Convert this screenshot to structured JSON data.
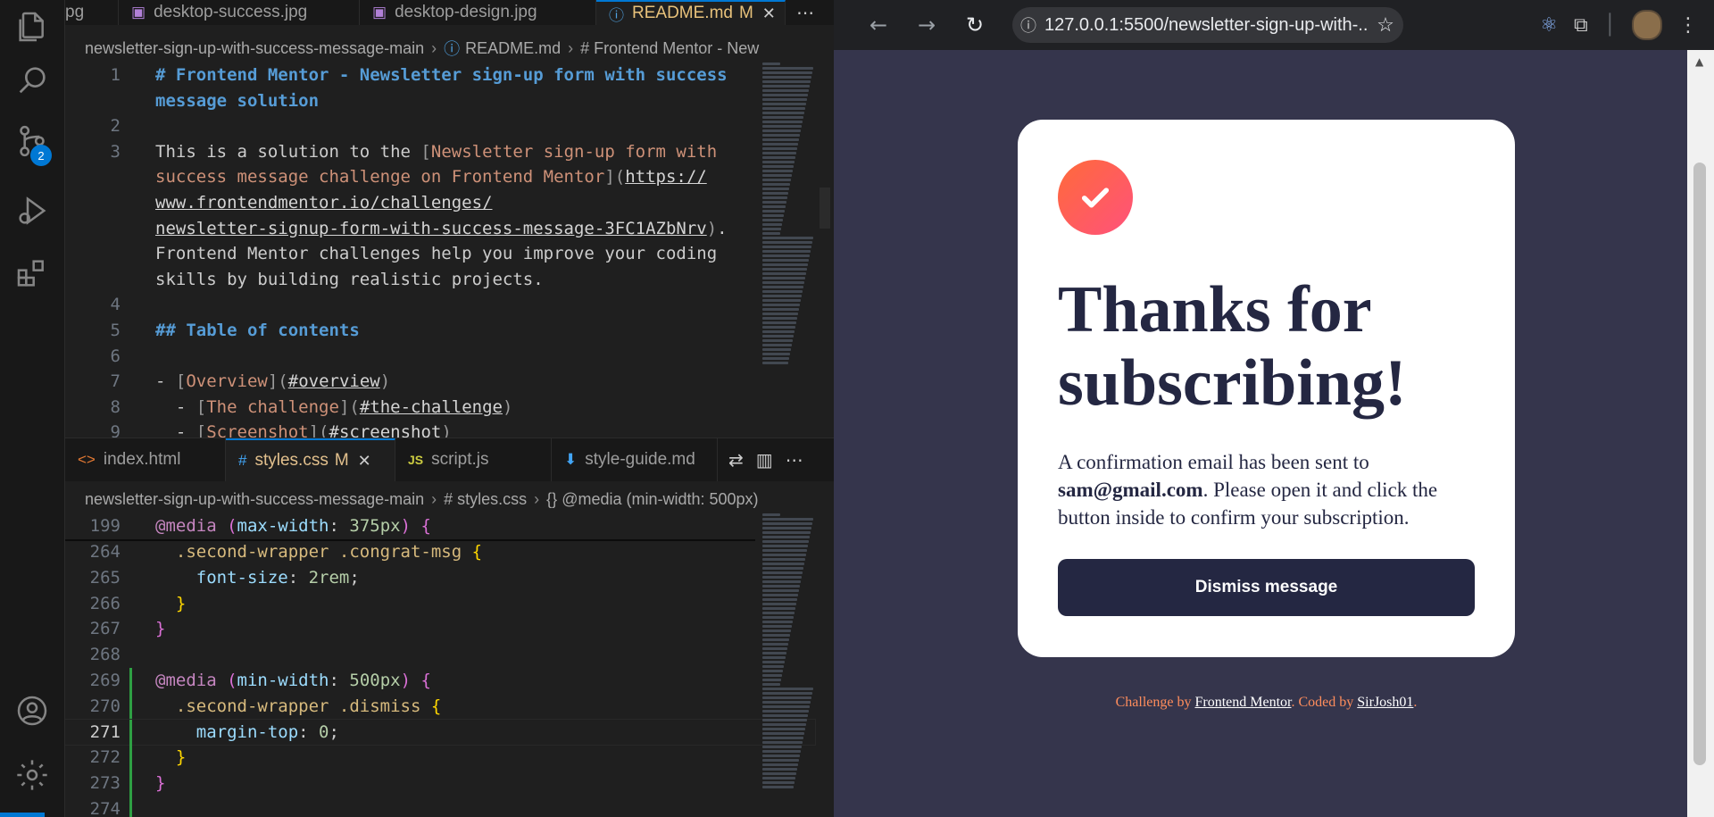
{
  "vscode": {
    "scm_badge": "2",
    "top_tabs": [
      {
        "label": "pg",
        "icon": "image-icon"
      },
      {
        "label": "desktop-success.jpg",
        "icon": "image-icon"
      },
      {
        "label": "desktop-design.jpg",
        "icon": "image-icon"
      },
      {
        "label": "README.md",
        "modified": "M",
        "icon": "info-icon"
      }
    ],
    "top_breadcrumb": [
      "newsletter-sign-up-with-success-message-main",
      "README.md",
      "# Frontend Mentor - New"
    ],
    "readme": {
      "line_numbers": [
        "1",
        "",
        "2",
        "3",
        "",
        "",
        "",
        "",
        "",
        "4",
        "5",
        "6",
        "7",
        "8",
        "9"
      ],
      "rows": [
        {
          "ln": "1",
          "parts": [
            {
              "c": "k-h",
              "t": "# Frontend Mentor - Newsletter sign-up form with success"
            }
          ]
        },
        {
          "ln": "",
          "parts": [
            {
              "c": "k-h",
              "t": "message solution"
            }
          ]
        },
        {
          "ln": "2",
          "parts": []
        },
        {
          "ln": "3",
          "parts": [
            {
              "c": "",
              "t": "This is a solution to the "
            },
            {
              "c": "k-br",
              "t": "["
            },
            {
              "c": "k-link",
              "t": "Newsletter sign-up form with"
            }
          ]
        },
        {
          "ln": "",
          "parts": [
            {
              "c": "k-link",
              "t": "success message challenge on Frontend Mentor"
            },
            {
              "c": "k-br",
              "t": "]("
            },
            {
              "c": "k-url",
              "t": "https://"
            }
          ]
        },
        {
          "ln": "",
          "parts": [
            {
              "c": "k-url",
              "t": "www.frontendmentor.io/challenges/"
            }
          ]
        },
        {
          "ln": "",
          "parts": [
            {
              "c": "k-url",
              "t": "newsletter-signup-form-with-success-message-3FC1AZbNrv"
            },
            {
              "c": "k-br",
              "t": ")"
            },
            {
              "c": "",
              "t": "."
            }
          ]
        },
        {
          "ln": "",
          "parts": [
            {
              "c": "",
              "t": "Frontend Mentor challenges help you improve your coding"
            }
          ]
        },
        {
          "ln": "",
          "parts": [
            {
              "c": "",
              "t": "skills by building realistic projects."
            }
          ]
        },
        {
          "ln": "4",
          "parts": []
        },
        {
          "ln": "5",
          "parts": [
            {
              "c": "k-h",
              "t": "## Table of contents"
            }
          ]
        },
        {
          "ln": "6",
          "parts": []
        },
        {
          "ln": "7",
          "parts": [
            {
              "c": "",
              "t": "- "
            },
            {
              "c": "k-br",
              "t": "["
            },
            {
              "c": "k-link",
              "t": "Overview"
            },
            {
              "c": "k-br",
              "t": "]("
            },
            {
              "c": "k-url",
              "t": "#overview"
            },
            {
              "c": "k-br",
              "t": ")"
            }
          ]
        },
        {
          "ln": "8",
          "parts": [
            {
              "c": "",
              "t": "  - "
            },
            {
              "c": "k-br",
              "t": "["
            },
            {
              "c": "k-link",
              "t": "The challenge"
            },
            {
              "c": "k-br",
              "t": "]("
            },
            {
              "c": "k-url",
              "t": "#the-challenge"
            },
            {
              "c": "k-br",
              "t": ")"
            }
          ]
        },
        {
          "ln": "9",
          "parts": [
            {
              "c": "",
              "t": "  - "
            },
            {
              "c": "k-br",
              "t": "["
            },
            {
              "c": "k-link",
              "t": "Screenshot"
            },
            {
              "c": "k-br",
              "t": "]("
            },
            {
              "c": "k-url",
              "t": "#screenshot"
            },
            {
              "c": "k-br",
              "t": ")"
            }
          ]
        }
      ]
    },
    "bottom_tabs": [
      {
        "label": "index.html",
        "icon": "html-icon",
        "ic": "<>"
      },
      {
        "label": "styles.css",
        "modified": "M",
        "icon": "css-icon",
        "ic": "#"
      },
      {
        "label": "script.js",
        "icon": "js-icon",
        "ic": "JS"
      },
      {
        "label": "style-guide.md",
        "icon": "markdown-icon",
        "ic": "⬇"
      }
    ],
    "bottom_breadcrumb": [
      "newsletter-sign-up-with-success-message-main",
      "# styles.css",
      "{} @media (min-width: 500px)"
    ],
    "css": {
      "sticky": {
        "ln": "199",
        "parts": [
          {
            "c": "k-at",
            "t": "@media"
          },
          {
            "c": "",
            "t": " "
          },
          {
            "c": "k-paren",
            "t": "("
          },
          {
            "c": "k-prop",
            "t": "max-width"
          },
          {
            "c": "",
            "t": ": "
          },
          {
            "c": "k-num",
            "t": "375px"
          },
          {
            "c": "k-paren",
            "t": ")"
          },
          {
            "c": "",
            "t": " "
          },
          {
            "c": "k-paren",
            "t": "{"
          }
        ]
      },
      "rows": [
        {
          "ln": "264",
          "parts": [
            {
              "c": "",
              "t": "  "
            },
            {
              "c": "k-sel",
              "t": ".second-wrapper .congrat-msg"
            },
            {
              "c": "",
              "t": " "
            },
            {
              "c": "k-brace",
              "t": "{"
            }
          ]
        },
        {
          "ln": "265",
          "parts": [
            {
              "c": "",
              "t": "    "
            },
            {
              "c": "k-prop",
              "t": "font-size"
            },
            {
              "c": "",
              "t": ": "
            },
            {
              "c": "k-num",
              "t": "2rem"
            },
            {
              "c": "",
              "t": ";"
            }
          ]
        },
        {
          "ln": "266",
          "parts": [
            {
              "c": "",
              "t": "  "
            },
            {
              "c": "k-brace",
              "t": "}"
            }
          ]
        },
        {
          "ln": "267",
          "parts": [
            {
              "c": "k-paren",
              "t": "}"
            }
          ]
        },
        {
          "ln": "268",
          "parts": []
        },
        {
          "ln": "269",
          "parts": [
            {
              "c": "k-at",
              "t": "@media"
            },
            {
              "c": "",
              "t": " "
            },
            {
              "c": "k-paren",
              "t": "("
            },
            {
              "c": "k-prop",
              "t": "min-width"
            },
            {
              "c": "",
              "t": ": "
            },
            {
              "c": "k-num",
              "t": "500px"
            },
            {
              "c": "k-paren",
              "t": ")"
            },
            {
              "c": "",
              "t": " "
            },
            {
              "c": "k-paren",
              "t": "{"
            }
          ]
        },
        {
          "ln": "270",
          "parts": [
            {
              "c": "",
              "t": "  "
            },
            {
              "c": "k-sel",
              "t": ".second-wrapper .dismiss"
            },
            {
              "c": "",
              "t": " "
            },
            {
              "c": "k-brace",
              "t": "{"
            }
          ]
        },
        {
          "ln": "271",
          "parts": [
            {
              "c": "",
              "t": "    "
            },
            {
              "c": "k-prop",
              "t": "margin-top"
            },
            {
              "c": "",
              "t": ": "
            },
            {
              "c": "k-num",
              "t": "0"
            },
            {
              "c": "",
              "t": ";"
            }
          ],
          "current": true
        },
        {
          "ln": "272",
          "parts": [
            {
              "c": "",
              "t": "  "
            },
            {
              "c": "k-brace",
              "t": "}"
            }
          ]
        },
        {
          "ln": "273",
          "parts": [
            {
              "c": "k-paren",
              "t": "}"
            }
          ]
        },
        {
          "ln": "274",
          "parts": []
        }
      ]
    }
  },
  "browser": {
    "url": "127.0.0.1:5500/newsletter-sign-up-with-...",
    "card": {
      "heading": "Thanks for subscribing!",
      "message_before": "A confirmation email has been sent to ",
      "email": "sam@gmail.com",
      "message_after": ". Please open it and click the button inside to confirm your subscription.",
      "button": "Dismiss message"
    },
    "attribution": {
      "prefix": "Challenge by ",
      "link1": "Frontend Mentor",
      "middle": ". Coded by ",
      "link2": "SirJosh01",
      "suffix": "."
    }
  },
  "colors": {
    "accent": "#0078d4",
    "card_bg": "#ffffff",
    "page_bg": "#35354c",
    "dark_navy": "#242742",
    "tomato": "#ff6155"
  }
}
